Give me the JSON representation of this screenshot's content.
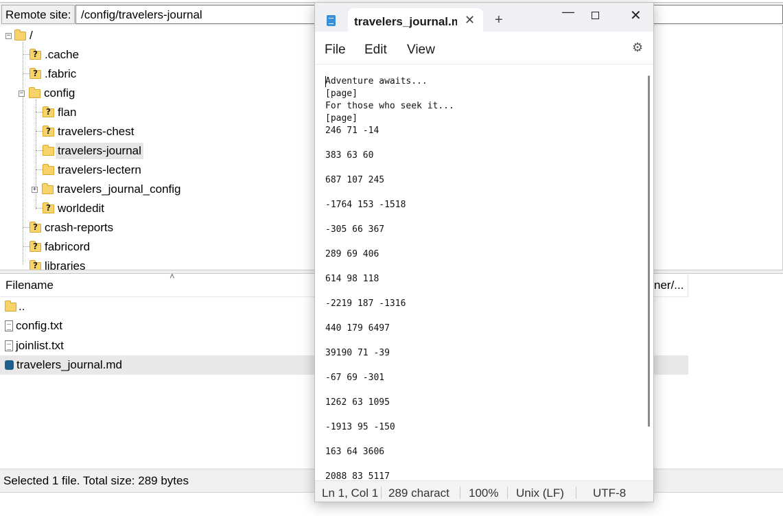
{
  "ftp": {
    "remote_label": "Remote site:",
    "remote_path": "/config/travelers-journal",
    "tree": [
      {
        "label": "/",
        "expander": "−",
        "question": false
      },
      {
        "label": ".cache",
        "question": true
      },
      {
        "label": ".fabric",
        "question": true
      },
      {
        "label": "config",
        "expander": "−",
        "question": false
      },
      {
        "label": "flan",
        "question": true
      },
      {
        "label": "travelers-chest",
        "question": true
      },
      {
        "label": "travelers-journal",
        "question": false,
        "selected": true
      },
      {
        "label": "travelers-lectern",
        "question": false
      },
      {
        "label": "travelers_journal_config",
        "expander": "+",
        "question": false
      },
      {
        "label": "worldedit",
        "question": true
      },
      {
        "label": "crash-reports",
        "question": true
      },
      {
        "label": "fabricord",
        "question": true
      },
      {
        "label": "libraries",
        "question": true
      }
    ],
    "list_header": {
      "filename": "Filename",
      "sort_arrow": "˄",
      "owner": "ner/..."
    },
    "files": [
      {
        "name": "..",
        "icon": "folder-icon"
      },
      {
        "name": "config.txt",
        "icon": "text-file-icon"
      },
      {
        "name": "joinlist.txt",
        "icon": "text-file-icon"
      },
      {
        "name": "travelers_journal.md",
        "icon": "markdown-file-icon",
        "selected": true
      }
    ],
    "status": "Selected 1 file. Total size: 289 bytes"
  },
  "notepad": {
    "tab_title": "travelers_journal.md",
    "tab_close": "✕",
    "new_tab": "+",
    "window_controls": {
      "minimize": "—",
      "close": "✕"
    },
    "menu": {
      "file": "File",
      "edit": "Edit",
      "view": "View"
    },
    "settings_icon": "⚙",
    "lines": [
      "Adventure awaits...",
      "[page]",
      "For those who seek it...",
      "[page]",
      "246 71 -14",
      "",
      "383 63 60",
      "",
      "687 107 245",
      "",
      "-1764 153 -1518",
      "",
      "-305 66 367",
      "",
      "289 69 406",
      "",
      "614 98 118",
      "",
      "-2219 187 -1316",
      "",
      "440 179 6497",
      "",
      "39190 71 -39",
      "",
      "-67 69 -301",
      "",
      "1262 63 1095",
      "",
      "-1913 95 -150",
      "",
      "163 64 3606",
      "",
      "2088 83 5117"
    ],
    "status": {
      "position": "Ln 1, Col 1",
      "chars": "289 charact",
      "zoom": "100%",
      "line_ending": "Unix (LF)",
      "encoding": "UTF-8"
    }
  }
}
